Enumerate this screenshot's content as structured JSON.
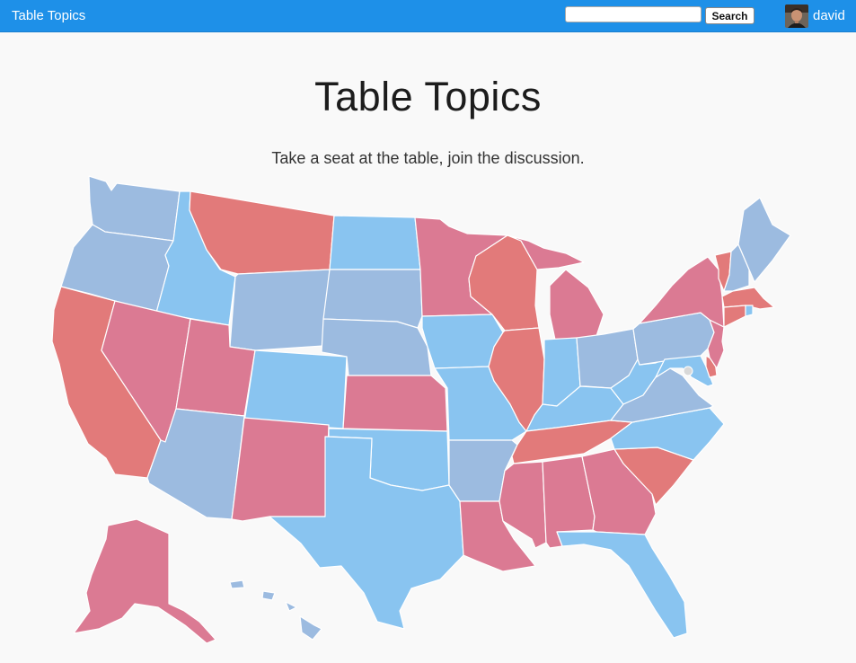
{
  "header": {
    "brand": "Table Topics",
    "search": {
      "placeholder": "",
      "value": "",
      "button_label": "Search"
    },
    "user": {
      "name": "david"
    }
  },
  "main": {
    "title": "Table Topics",
    "subtitle": "Take a seat at the table, join the discussion."
  },
  "map": {
    "colors": {
      "strong_blue": "#89c4f0",
      "soft_blue": "#9cbbe0",
      "red": "#e27a7a",
      "pink": "#db7a93",
      "dc_marker": "#d8d8d8"
    }
  }
}
